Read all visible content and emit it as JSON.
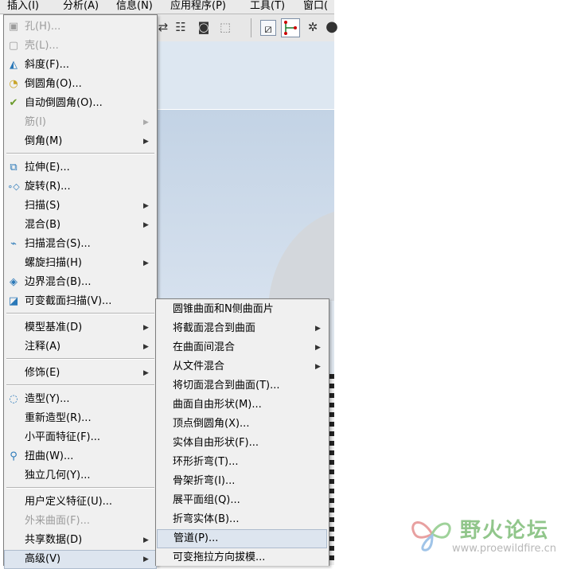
{
  "menubar": {
    "items": [
      "插入(I)",
      "分析(A)",
      "信息(N)",
      "应用程序(P)",
      "工具(T)",
      "窗口("
    ]
  },
  "insert_menu": {
    "items": [
      {
        "label": "孔(H)...",
        "icon": "hole-icon",
        "enabled": false
      },
      {
        "label": "壳(L)...",
        "icon": "shell-icon",
        "enabled": false
      },
      {
        "label": "斜度(F)...",
        "icon": "draft-icon",
        "enabled": true
      },
      {
        "label": "倒圆角(O)...",
        "icon": "round-icon",
        "enabled": true
      },
      {
        "label": "自动倒圆角(O)...",
        "icon": "auto-round-icon",
        "enabled": true
      },
      {
        "label": "筋(I)",
        "enabled": false,
        "submenu": true
      },
      {
        "label": "倒角(M)",
        "enabled": true,
        "submenu": true
      },
      {
        "label": "拉伸(E)...",
        "icon": "extrude-icon",
        "enabled": true
      },
      {
        "label": "旋转(R)...",
        "icon": "revolve-icon",
        "enabled": true
      },
      {
        "label": "扫描(S)",
        "enabled": true,
        "submenu": true
      },
      {
        "label": "混合(B)",
        "enabled": true,
        "submenu": true
      },
      {
        "label": "扫描混合(S)...",
        "icon": "swept-blend-icon",
        "enabled": true
      },
      {
        "label": "螺旋扫描(H)",
        "enabled": true,
        "submenu": true
      },
      {
        "label": "边界混合(B)...",
        "icon": "boundary-blend-icon",
        "enabled": true
      },
      {
        "label": "可变截面扫描(V)...",
        "icon": "var-section-sweep-icon",
        "enabled": true
      },
      {
        "label": "模型基准(D)",
        "enabled": true,
        "submenu": true
      },
      {
        "label": "注释(A)",
        "enabled": true,
        "submenu": true
      },
      {
        "label": "修饰(E)",
        "enabled": true,
        "submenu": true
      },
      {
        "label": "造型(Y)...",
        "icon": "style-icon",
        "enabled": true
      },
      {
        "label": "重新造型(R)...",
        "enabled": true
      },
      {
        "label": "小平面特征(F)...",
        "enabled": true
      },
      {
        "label": "扭曲(W)...",
        "icon": "warp-icon",
        "enabled": true
      },
      {
        "label": "独立几何(Y)...",
        "enabled": true
      },
      {
        "label": "用户定义特征(U)...",
        "enabled": true
      },
      {
        "label": "外来曲面(F)...",
        "enabled": false
      },
      {
        "label": "共享数据(D)",
        "enabled": true,
        "submenu": true
      },
      {
        "label": "高级(V)",
        "enabled": true,
        "submenu": true,
        "highlighted": true
      }
    ]
  },
  "advanced_menu": {
    "items": [
      {
        "label": "圆锥曲面和N侧曲面片"
      },
      {
        "label": "将截面混合到曲面",
        "submenu": true
      },
      {
        "label": "在曲面间混合",
        "submenu": true
      },
      {
        "label": "从文件混合",
        "submenu": true
      },
      {
        "label": "将切面混合到曲面(T)..."
      },
      {
        "label": "曲面自由形状(M)..."
      },
      {
        "label": "顶点倒圆角(X)..."
      },
      {
        "label": "实体自由形状(F)..."
      },
      {
        "label": "环形折弯(T)..."
      },
      {
        "label": "骨架折弯(I)..."
      },
      {
        "label": "展平面组(Q)..."
      },
      {
        "label": "折弯实体(B)..."
      },
      {
        "label": "管道(P)...",
        "highlighted": true
      },
      {
        "label": "可变拖拉方向拔模..."
      }
    ]
  },
  "toolbar": {
    "icons": [
      "regen-icon",
      "regen-manager-icon",
      "binoculars-find-icon",
      "selection-box-icon",
      "datum-display-icon",
      "datum-points-icon",
      "spin-center-icon",
      "shading-icon"
    ]
  },
  "watermark": {
    "title": "野火论坛",
    "url": "www.proewildfire.cn"
  },
  "colors": {
    "menu_bg": "#f0f0f0",
    "highlight": "#dde5ef",
    "disabled_text": "#9c9c9c",
    "watermark_green": "#86c07f"
  }
}
